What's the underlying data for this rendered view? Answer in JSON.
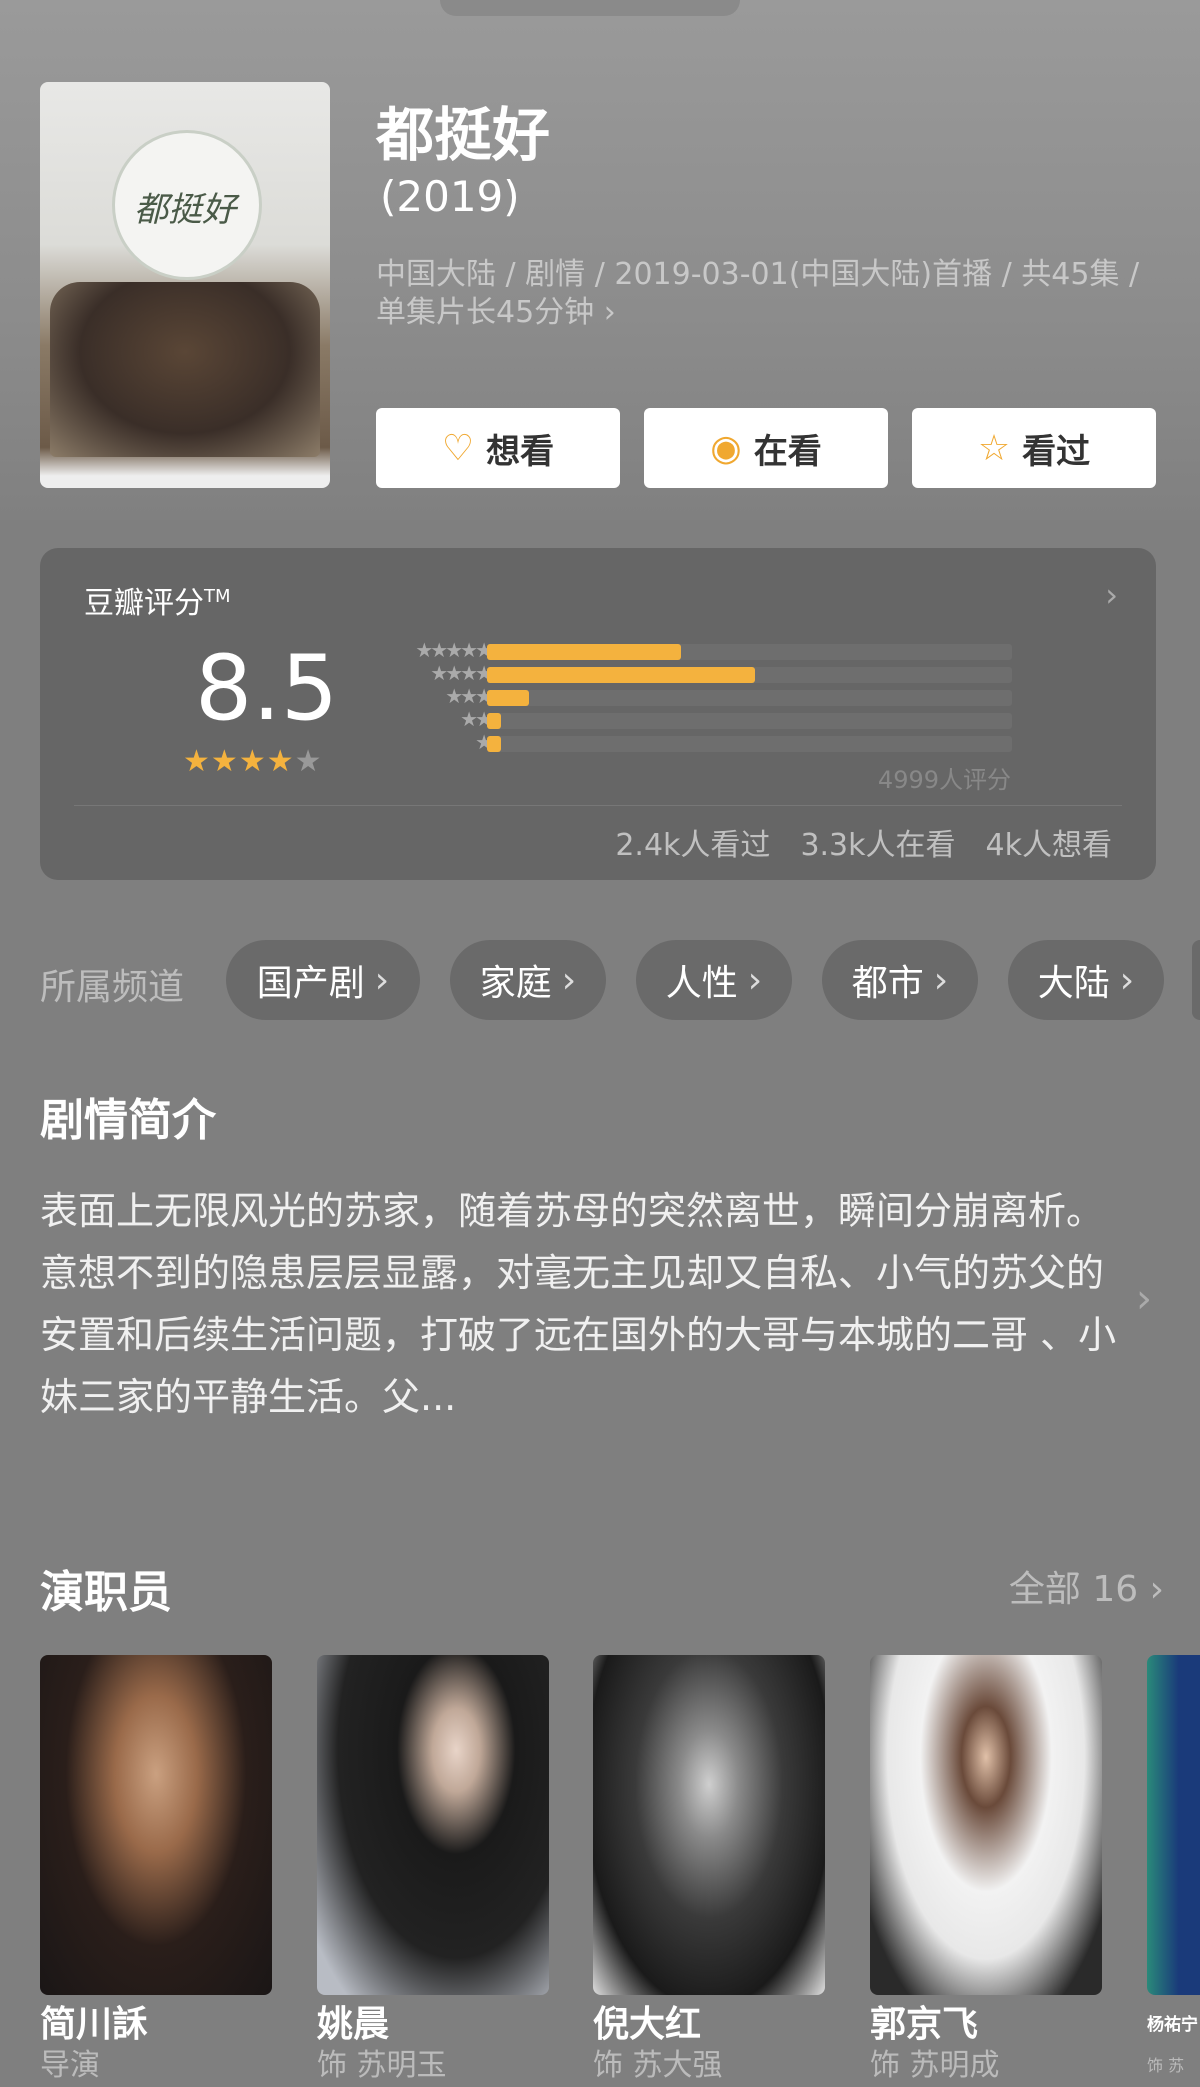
{
  "show": {
    "title": "都挺好",
    "year": "(2019)",
    "meta": "中国大陆 / 剧情 / 2019-03-01(中国大陆)首播 / 共45集 / 单集片长45分钟 ›",
    "poster_text": "都挺好"
  },
  "actions": [
    {
      "label": "想看",
      "icon": "heart-plus-icon",
      "glyph": "♡"
    },
    {
      "label": "在看",
      "icon": "target-icon",
      "glyph": "◉"
    },
    {
      "label": "看过",
      "icon": "star-outline-icon",
      "glyph": "☆"
    }
  ],
  "rating": {
    "label": "豆瓣评分",
    "tm": "TM",
    "score": "8.5",
    "stars": 4,
    "max_stars": 5,
    "distribution": [
      {
        "stars": "★★★★★",
        "percent": 37
      },
      {
        "stars": "★★★★",
        "percent": 51
      },
      {
        "stars": "★★★",
        "percent": 8
      },
      {
        "stars": "★★",
        "percent": 2
      },
      {
        "stars": "★",
        "percent": 2
      }
    ],
    "total": "4999人评分",
    "counts": [
      "2.4k人看过",
      "3.3k人在看",
      "4k人想看"
    ],
    "accent": "#f4b23e"
  },
  "channels": {
    "label": "所属频道",
    "items": [
      "国产剧",
      "家庭",
      "人性",
      "都市",
      "大陆"
    ]
  },
  "synopsis": {
    "title": "剧情简介",
    "text": "表面上无限风光的苏家，随着苏母的突然离世，瞬间分崩离析。意想不到的隐患层层显露，对毫无主见却又自私、小气的苏父的安置和后续生活问题，打破了远在国外的大哥与本城的二哥 、小妹三家的平静生活。父..."
  },
  "cast": {
    "title": "演职员",
    "all": "全部 16 ›",
    "members": [
      {
        "name": "简川訸",
        "role": "导演"
      },
      {
        "name": "姚晨",
        "role": "饰 苏明玉"
      },
      {
        "name": "倪大红",
        "role": "饰 苏大强"
      },
      {
        "name": "郭京飞",
        "role": "饰 苏明成"
      },
      {
        "name": "杨祐宁",
        "role": "饰 苏"
      }
    ]
  }
}
